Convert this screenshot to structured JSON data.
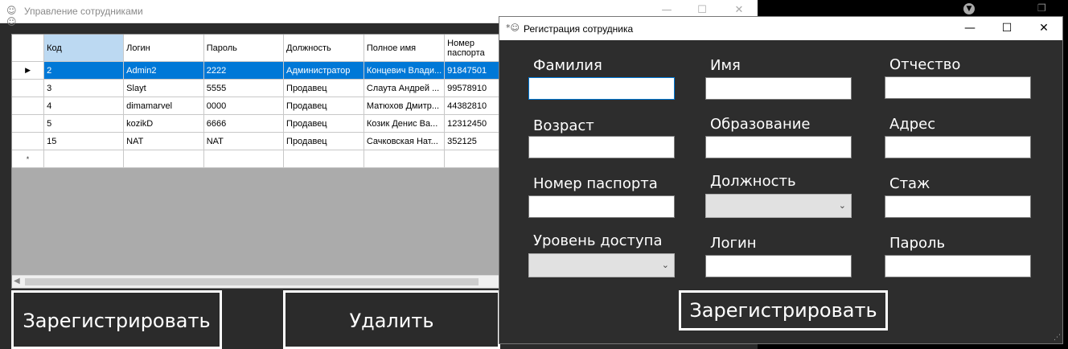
{
  "main_window": {
    "title": "Управление сотрудниками",
    "title_icon": "users-icon",
    "controls": {
      "minimize": "—",
      "maximize": "☐",
      "close": "✕"
    }
  },
  "grid": {
    "columns": [
      "Код",
      "Логин",
      "Пароль",
      "Должность",
      "Полное имя",
      "Номер паспорта"
    ],
    "rows": [
      [
        "2",
        "Admin2",
        "2222",
        "Администратор",
        "Концевич Влади...",
        "91847501"
      ],
      [
        "3",
        "Slayt",
        "5555",
        "Продавец",
        "Слаута Андрей ...",
        "99578910"
      ],
      [
        "4",
        "dimamarvel",
        "0000",
        "Продавец",
        "Матюхов Дмитр...",
        "44382810"
      ],
      [
        "5",
        "kozikD",
        "6666",
        "Продавец",
        "Козик Денис Ва...",
        "12312450"
      ],
      [
        "15",
        "NAT",
        "NAT",
        "Продавец",
        "Сачковская Нат...",
        "352125"
      ]
    ],
    "active_row_marker": "▶",
    "new_row_marker": "*"
  },
  "main_buttons": {
    "register": "Зарегистрировать",
    "delete": "Удалить"
  },
  "dialog": {
    "title": "Регистрация сотрудника",
    "title_icon": "user-add-icon",
    "controls": {
      "minimize": "—",
      "maximize": "☐",
      "close": "✕"
    },
    "fields": {
      "last_name": {
        "label": "Фамилия",
        "value": ""
      },
      "first_name": {
        "label": "Имя",
        "value": ""
      },
      "patronymic": {
        "label": "Отчество",
        "value": ""
      },
      "age": {
        "label": "Возраст",
        "value": ""
      },
      "education": {
        "label": "Образование",
        "value": ""
      },
      "address": {
        "label": "Адрес",
        "value": ""
      },
      "passport": {
        "label": "Номер паспорта",
        "value": ""
      },
      "position": {
        "label": "Должность",
        "value": ""
      },
      "experience": {
        "label": "Стаж",
        "value": ""
      },
      "access_level": {
        "label": "Уровень доступа",
        "value": ""
      },
      "login": {
        "label": "Логин",
        "value": ""
      },
      "password": {
        "label": "Пароль",
        "value": ""
      }
    },
    "submit": "Зарегистрировать"
  },
  "taskbar": {
    "dropdown_icon": "chevron-down-circle-icon"
  },
  "colors": {
    "selection": "#0078d7",
    "dialog_bg": "#2d2d2d",
    "header_selected": "#bcd9f2"
  }
}
